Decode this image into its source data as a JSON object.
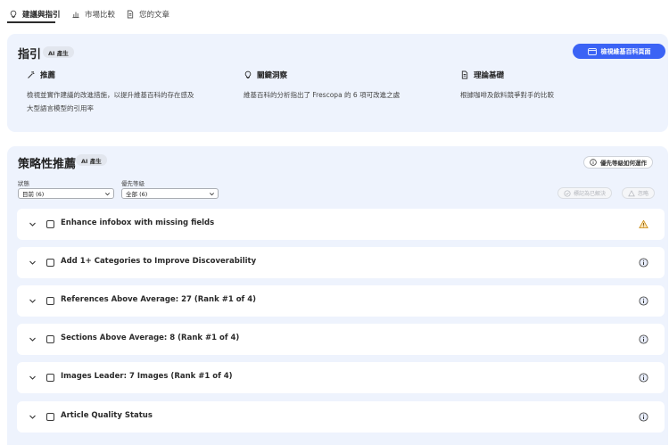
{
  "tabs": [
    {
      "label": "建議與指引",
      "icon": "lightbulb-icon",
      "active": true
    },
    {
      "label": "市場比較",
      "icon": "bar-chart-icon",
      "active": false
    },
    {
      "label": "您的文章",
      "icon": "document-icon",
      "active": false
    }
  ],
  "guide": {
    "title": "指引",
    "badge": "AI 產生",
    "view_button": "檢視維基百科頁面",
    "columns": [
      {
        "icon": "magic-wand-icon",
        "heading": "推薦",
        "text_lines": [
          "檢視並實作建議的改進措施，以提升維基百科的存在感及",
          "大型語言模型的引用率"
        ]
      },
      {
        "icon": "lightbulb-icon",
        "heading": "關鍵洞察",
        "text_lines": [
          "維基百科的分析指出了 Frescopa 的 6 項可改進之處"
        ]
      },
      {
        "icon": "document-icon",
        "heading": "理論基礎",
        "text_lines": [
          "根據咖啡及飲料競爭對手的比較"
        ]
      }
    ]
  },
  "strategy": {
    "title": "策略性推薦",
    "badge": "AI 產生",
    "priority_help_button": "優先等級如何運作",
    "filters": {
      "status_label": "狀態",
      "status_value": "目前 (6)",
      "priority_label": "優先等級",
      "priority_value": "全部 (6)"
    },
    "actions": {
      "mark_done": "標記為已解決",
      "dismiss": "忽略"
    },
    "recommendations": [
      {
        "title": "Enhance infobox with missing fields",
        "status_icon": "warning-icon"
      },
      {
        "title": "Add 1+ Categories to Improve Discoverability",
        "status_icon": "info-icon"
      },
      {
        "title": "References Above Average: 27 (Rank #1 of 4)",
        "status_icon": "info-icon"
      },
      {
        "title": "Sections Above Average: 8 (Rank #1 of 4)",
        "status_icon": "info-icon"
      },
      {
        "title": "Images Leader: 7 Images (Rank #1 of 4)",
        "status_icon": "info-icon"
      },
      {
        "title": "Article Quality Status",
        "status_icon": "info-icon"
      }
    ]
  },
  "colors": {
    "accent": "#3b63f5",
    "card_background": "#eef3fd",
    "warning": "#e8a317",
    "info": "#4b4b4b"
  }
}
